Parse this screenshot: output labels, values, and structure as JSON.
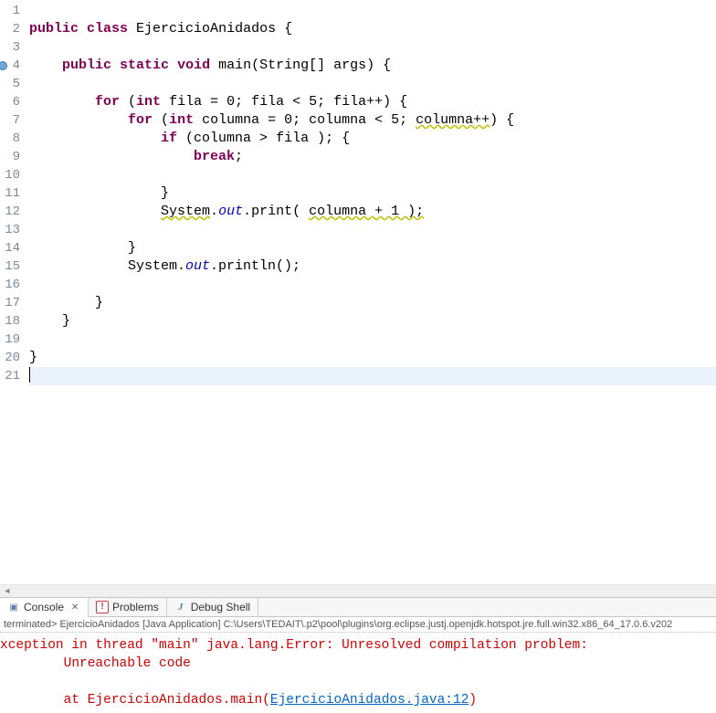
{
  "editor": {
    "lines": [
      {
        "n": 1,
        "html": ""
      },
      {
        "n": 2,
        "html": "<span class=\"kw\">public</span> <span class=\"kw\">class</span> EjercicioAnidados {"
      },
      {
        "n": 3,
        "html": ""
      },
      {
        "n": 4,
        "html": "    <span class=\"kw\">public</span> <span class=\"kw\">static</span> <span class=\"kw\">void</span> main(String[] args) {",
        "marker": true
      },
      {
        "n": 5,
        "html": ""
      },
      {
        "n": 6,
        "html": "        <span class=\"kw\">for</span> (<span class=\"kw\">int</span> fila = 0; fila &lt; 5; fila++) {"
      },
      {
        "n": 7,
        "html": "            <span class=\"kw\">for</span> (<span class=\"kw\">int</span> columna = 0; columna &lt; 5; <span class=\"warn\">columna++</span>) {"
      },
      {
        "n": 8,
        "html": "                <span class=\"kw\">if</span> (columna &gt; fila ); {"
      },
      {
        "n": 9,
        "html": "                    <span class=\"kw\">break</span>;"
      },
      {
        "n": 10,
        "html": ""
      },
      {
        "n": 11,
        "html": "                }"
      },
      {
        "n": 12,
        "html": "                <span class=\"warn\">System</span>.<span class=\"field\">out</span>.print( <span class=\"warn\">columna + 1 );</span>"
      },
      {
        "n": 13,
        "html": ""
      },
      {
        "n": 14,
        "html": "            }"
      },
      {
        "n": 15,
        "html": "            System.<span class=\"field\">out</span>.println();"
      },
      {
        "n": 16,
        "html": ""
      },
      {
        "n": 17,
        "html": "        }"
      },
      {
        "n": 18,
        "html": "    }"
      },
      {
        "n": 19,
        "html": ""
      },
      {
        "n": 20,
        "html": "}"
      },
      {
        "n": 21,
        "html": "",
        "current": true
      }
    ]
  },
  "tabs": {
    "console": "Console",
    "problems": "Problems",
    "debug": "Debug Shell"
  },
  "console": {
    "header": "terminated> EjercicioAnidados [Java Application] C:\\Users\\TEDAIT\\.p2\\pool\\plugins\\org.eclipse.justj.openjdk.hotspot.jre.full.win32.x86_64_17.0.6.v202",
    "line1": "xception in thread \"main\" java.lang.Error: Unresolved compilation problem: ",
    "line2": "\tUnreachable code",
    "blank": "",
    "line3_prefix": "\tat EjercicioAnidados.main(",
    "line3_link": "EjercicioAnidados.java:12",
    "line3_suffix": ")"
  }
}
